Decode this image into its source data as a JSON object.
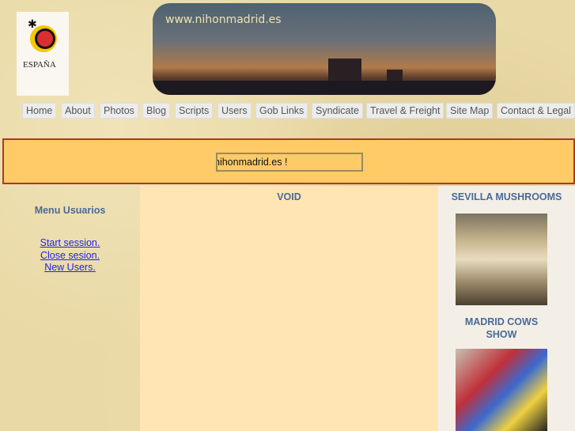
{
  "header": {
    "logo_text": "ESPAÑA",
    "banner_url": "www.nihonmadrid.es"
  },
  "nav": [
    "Home",
    "About",
    "Photos",
    "Blog",
    "Scripts",
    "Users",
    "Gob Links",
    "Syndicate",
    "Travel & Freight",
    "Site Map",
    "Contact & Legal"
  ],
  "marquee": {
    "text": "nihonmadrid.es !"
  },
  "left": {
    "title": "Menu Usuarios",
    "links": [
      "Start session.",
      "Close sesion.",
      "New Users."
    ]
  },
  "center": {
    "title": "VOID"
  },
  "right": {
    "items": [
      {
        "title": "SEVILLA MUSHROOMS"
      },
      {
        "title": "MADRID COWS SHOW"
      }
    ]
  }
}
